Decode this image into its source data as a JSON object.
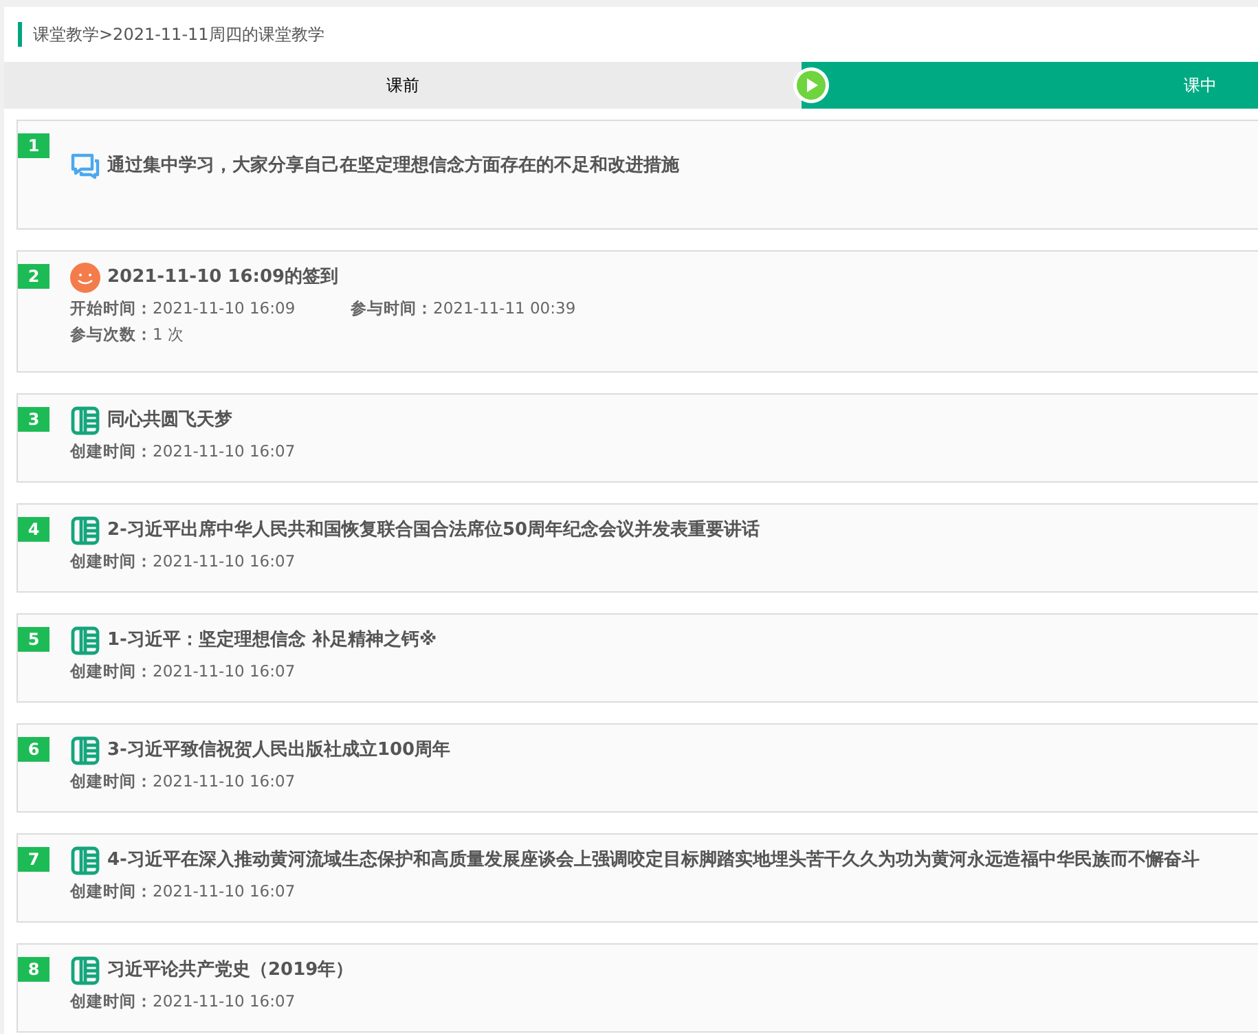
{
  "breadcrumb": "课堂教学>2021-11-11周四的课堂教学",
  "tabs": [
    {
      "label": "课前",
      "selected": false
    },
    {
      "label": "课中",
      "selected": true
    }
  ],
  "items": [
    {
      "kind": "discussion",
      "number": "1",
      "title": "通过集中学习，大家分享自己在坚定理想信念方面存在的不足和改进措施"
    },
    {
      "kind": "signin",
      "number": "2",
      "title": "2021-11-10 16:09的签到",
      "fields": [
        {
          "label": "开始时间：",
          "value": "2021-11-10 16:09"
        },
        {
          "label": "参与时间：",
          "value": "2021-11-11 00:39"
        },
        {
          "label": "参与次数：",
          "value": "1 次"
        }
      ]
    },
    {
      "kind": "resource",
      "number": "3",
      "title": "同心共圆飞天梦",
      "fields": [
        {
          "label": "创建时间：",
          "value": "2021-11-10 16:07"
        }
      ]
    },
    {
      "kind": "resource",
      "number": "4",
      "title": "2-习近平出席中华人民共和国恢复联合国合法席位50周年纪念会议并发表重要讲话",
      "fields": [
        {
          "label": "创建时间：",
          "value": "2021-11-10 16:07"
        }
      ]
    },
    {
      "kind": "resource",
      "number": "5",
      "title": "1-习近平：坚定理想信念 补足精神之钙※",
      "fields": [
        {
          "label": "创建时间：",
          "value": "2021-11-10 16:07"
        }
      ]
    },
    {
      "kind": "resource",
      "number": "6",
      "title": "3-习近平致信祝贺人民出版社成立100周年",
      "fields": [
        {
          "label": "创建时间：",
          "value": "2021-11-10 16:07"
        }
      ]
    },
    {
      "kind": "resource",
      "number": "7",
      "title": "4-习近平在深入推动黄河流域生态保护和高质量发展座谈会上强调咬定目标脚踏实地埋头苦干久久为功为黄河永远造福中华民族而不懈奋斗",
      "fields": [
        {
          "label": "创建时间：",
          "value": "2021-11-10 16:07"
        }
      ]
    },
    {
      "kind": "resource",
      "number": "8",
      "title": "习近平论共产党史（2019年）",
      "fields": [
        {
          "label": "创建时间：",
          "value": "2021-11-10 16:07"
        }
      ]
    }
  ]
}
